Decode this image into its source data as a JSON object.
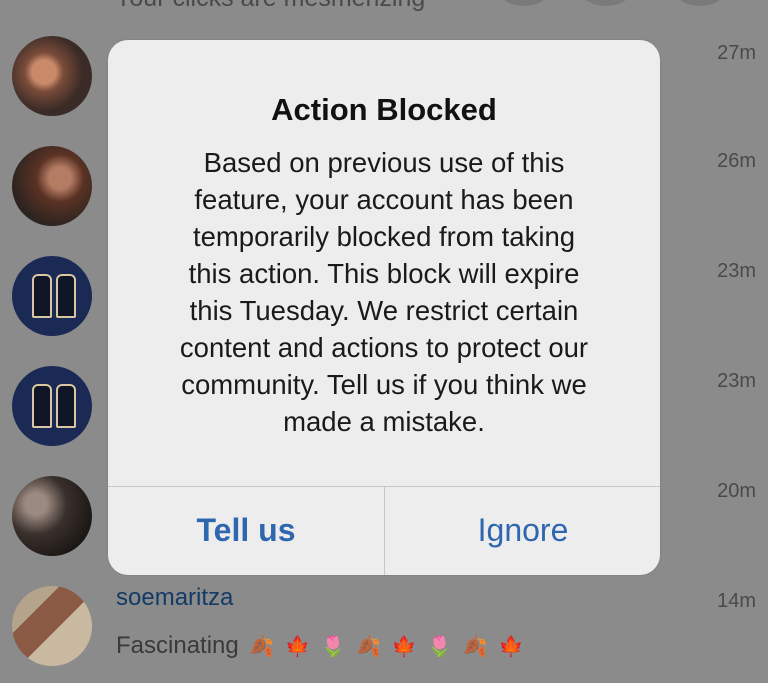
{
  "feed": {
    "truncated_top_text": "Your clicks are mesmerizing",
    "times": [
      "27m",
      "26m",
      "23m",
      "23m",
      "20m",
      "14m"
    ],
    "last_comment": {
      "username": "soemaritza",
      "text": "Fascinating",
      "emoji": [
        "🍂",
        "🍁",
        "🌷",
        "🍂",
        "🍁",
        "🌷",
        "🍂",
        "🍁"
      ]
    }
  },
  "dialog": {
    "title": "Action Blocked",
    "lines": [
      "Based on previous use of this",
      "feature, your account has been",
      "temporarily blocked from taking",
      "this action. This block will expire",
      "this Tuesday. We restrict certain",
      "content and actions to protect our",
      "community. Tell us if you think we",
      "made a mistake."
    ],
    "buttons": {
      "tell_us": "Tell us",
      "ignore": "Ignore"
    }
  }
}
